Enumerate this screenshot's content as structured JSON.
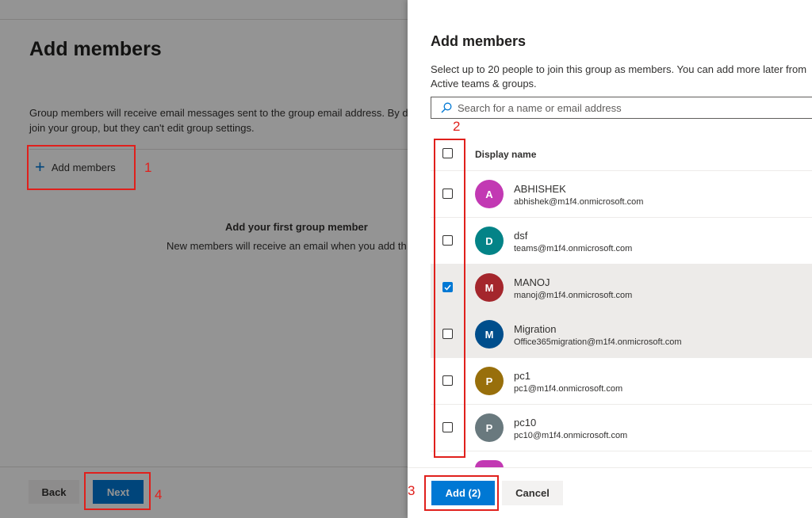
{
  "background_page": {
    "title": "Add members",
    "description_line1": "Group members will receive email messages sent to the group email address. By d",
    "description_line2": "join your group, but they can't edit group settings.",
    "add_members_label": "Add members",
    "empty_state_title": "Add your first group member",
    "empty_state_subtitle": "New members will receive an email when you add th",
    "back_label": "Back",
    "next_label": "Next"
  },
  "panel": {
    "title": "Add members",
    "description_line1": "Select up to 20 people to join this group as members. You can add more later from",
    "description_line2": "Active teams & groups.",
    "search_placeholder": "Search for a name or email address",
    "column_header": "Display name",
    "users": [
      {
        "initial": "A",
        "name": "ABHISHEK",
        "email": "abhishek@m1f4.onmicrosoft.com",
        "color": "#c239b3",
        "checked": false
      },
      {
        "initial": "D",
        "name": "dsf",
        "email": "teams@m1f4.onmicrosoft.com",
        "color": "#038387",
        "checked": false
      },
      {
        "initial": "M",
        "name": "MANOJ",
        "email": "manoj@m1f4.onmicrosoft.com",
        "color": "#a4262c",
        "checked": true
      },
      {
        "initial": "M",
        "name": "Migration",
        "email": "Office365migration@m1f4.onmicrosoft.com",
        "color": "#004e8c",
        "checked": false
      },
      {
        "initial": "P",
        "name": "pc1",
        "email": "pc1@m1f4.onmicrosoft.com",
        "color": "#986f0b",
        "checked": false
      },
      {
        "initial": "P",
        "name": "pc10",
        "email": "pc10@m1f4.onmicrosoft.com",
        "color": "#69797e",
        "checked": false
      }
    ],
    "add_button_label": "Add (2)",
    "cancel_button_label": "Cancel"
  },
  "annotations": [
    "1",
    "2",
    "3",
    "4"
  ],
  "colors": {
    "accent": "#0078d4",
    "annotation": "#e0201c"
  }
}
